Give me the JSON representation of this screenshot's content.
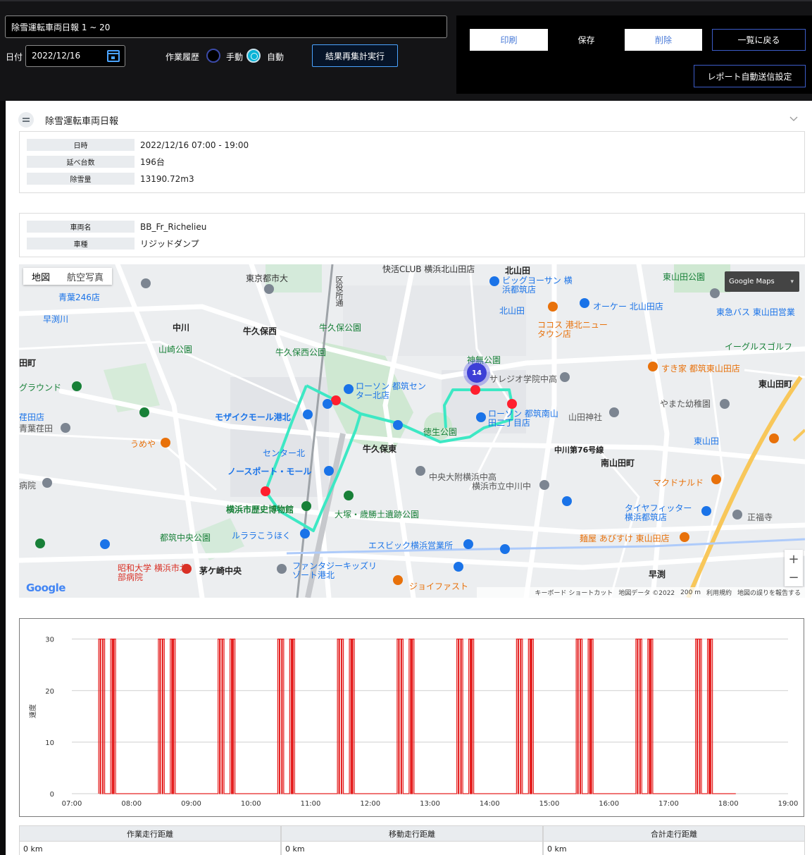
{
  "header": {
    "title_value": "除雪運転車両日報 1 ~ 20",
    "date_label": "日付",
    "date_value": "2022/12/16",
    "history_label": "作業履歴",
    "radio_manual": "手動",
    "radio_auto": "自動",
    "selected_mode": "自動",
    "recalc_button": "結果再集計実行"
  },
  "actions": {
    "print": "印刷",
    "save": "保存",
    "delete": "削除",
    "back": "一覧に戻る",
    "report": "レポート自動送信設定"
  },
  "section": {
    "title": "除雪運転車両日報"
  },
  "summary": [
    {
      "key": "日時",
      "value": "2022/12/16 07:00 - 19:00"
    },
    {
      "key": "延べ台数",
      "value": "196台"
    },
    {
      "key": "除雪量",
      "value": "13190.72m3"
    }
  ],
  "vehicle": [
    {
      "key": "車両名",
      "value": "BB_Fr_Richelieu"
    },
    {
      "key": "車種",
      "value": "リジッドダンプ"
    }
  ],
  "map": {
    "type_map": "地図",
    "type_satellite": "航空写真",
    "badge": "Google Maps",
    "cluster_count": "14",
    "google": "Google",
    "footer": [
      "キーボード ショートカット",
      "地図データ ©2022",
      "200 m",
      "利用規約",
      "地図の誤りを報告する"
    ],
    "labels": [
      {
        "text": "東京都市大",
        "color": "#333"
      },
      {
        "text": "快活CLUB 横浜北山田店",
        "color": "#333"
      },
      {
        "text": "北山田",
        "color": "#222"
      },
      {
        "text": "ビッグヨーサン 横浜都筑店",
        "color": "#1a73e8"
      },
      {
        "text": "オーケー 北山田店",
        "color": "#1a73e8"
      },
      {
        "text": "東山田公園",
        "color": "#188038"
      },
      {
        "text": "東急バス 東山田営業",
        "color": "#1a73e8"
      },
      {
        "text": "中川",
        "color": "#222"
      },
      {
        "text": "牛久保西",
        "color": "#222"
      },
      {
        "text": "牛久保公園",
        "color": "#188038"
      },
      {
        "text": "ココス 港北ニュータウン店",
        "color": "#e8710a"
      },
      {
        "text": "イーグルスゴルフ",
        "color": "#188038"
      },
      {
        "text": "山崎公園",
        "color": "#188038"
      },
      {
        "text": "牛久保西公園",
        "color": "#188038"
      },
      {
        "text": "神無公園",
        "color": "#188038"
      },
      {
        "text": "サレジオ学院中高",
        "color": "#555"
      },
      {
        "text": "すき家 都筑東山田店",
        "color": "#e8710a"
      },
      {
        "text": "東山田町",
        "color": "#222"
      },
      {
        "text": "ローソン 都筑センター北店",
        "color": "#1a73e8"
      },
      {
        "text": "やまた幼稚園",
        "color": "#555"
      },
      {
        "text": "ローソン 都筑南山田二丁目店",
        "color": "#1a73e8"
      },
      {
        "text": "山田神社",
        "color": "#555"
      },
      {
        "text": "モザイクモール港北",
        "color": "#1a73e8"
      },
      {
        "text": "徳生公園",
        "color": "#188038"
      },
      {
        "text": "うめや",
        "color": "#e8710a"
      },
      {
        "text": "牛久保東",
        "color": "#222"
      },
      {
        "text": "中川第76号線",
        "color": "#222"
      },
      {
        "text": "南山田町",
        "color": "#222"
      },
      {
        "text": "センター北",
        "color": "#1a73e8"
      },
      {
        "text": "ノースポート・モール",
        "color": "#1a73e8"
      },
      {
        "text": "中央大附横浜中高",
        "color": "#555"
      },
      {
        "text": "横浜市立中川中",
        "color": "#555"
      },
      {
        "text": "マクドナルド",
        "color": "#e8710a"
      },
      {
        "text": "横浜市歴史博物館",
        "color": "#188038"
      },
      {
        "text": "大塚・歳勝土遺跡公園",
        "color": "#188038"
      },
      {
        "text": "タイヤフィッター 横浜都筑店",
        "color": "#1a73e8"
      },
      {
        "text": "正福寺",
        "color": "#555"
      },
      {
        "text": "都筑中央公園",
        "color": "#188038"
      },
      {
        "text": "ルララこうほく",
        "color": "#1a73e8"
      },
      {
        "text": "エスビック横浜営業所",
        "color": "#1a73e8"
      },
      {
        "text": "麺屋 あびすけ 東山田店",
        "color": "#e8710a"
      },
      {
        "text": "昭和大学 横浜市北部病院",
        "color": "#d93025"
      },
      {
        "text": "茅ケ崎中央",
        "color": "#222"
      },
      {
        "text": "ファンタジーキッズリゾート港北",
        "color": "#1a73e8"
      },
      {
        "text": "ジョイファスト",
        "color": "#e8710a"
      },
      {
        "text": "早渕",
        "color": "#222"
      },
      {
        "text": "早渕川",
        "color": "#1a73e8"
      },
      {
        "text": "青葉246店",
        "color": "#1a73e8"
      },
      {
        "text": "区役所通",
        "color": "#333"
      },
      {
        "text": "田町",
        "color": "#222"
      },
      {
        "text": "グラウンド",
        "color": "#188038"
      },
      {
        "text": "荏田店",
        "color": "#1a73e8"
      },
      {
        "text": "青葉荏田",
        "color": "#555"
      },
      {
        "text": "病院",
        "color": "#555"
      },
      {
        "text": "北山田",
        "color": "#1a73e8"
      },
      {
        "text": "東山田",
        "color": "#1a73e8"
      }
    ],
    "route_color": "#3de8c4",
    "marker_color": "#ff1f2e"
  },
  "chart_data": {
    "type": "line",
    "xlabel": "",
    "ylabel": "速度",
    "x_ticks": [
      "07:00",
      "08:00",
      "09:00",
      "10:00",
      "11:00",
      "12:00",
      "13:00",
      "14:00",
      "15:00",
      "16:00",
      "17:00",
      "18:00",
      "19:00"
    ],
    "y_ticks": [
      0,
      10,
      20,
      30
    ],
    "ylim": [
      0,
      32
    ],
    "xlim": [
      "07:00",
      "19:00"
    ],
    "grid": true,
    "line_color": "#e52020",
    "series": [
      {
        "pulses": [
          [
            "07:27",
            "07:33"
          ],
          [
            "07:39",
            "07:44"
          ],
          [
            "08:27",
            "08:33"
          ],
          [
            "08:39",
            "08:44"
          ],
          [
            "09:27",
            "09:33"
          ],
          [
            "09:39",
            "09:44"
          ],
          [
            "10:27",
            "10:33"
          ],
          [
            "10:39",
            "10:44"
          ],
          [
            "11:27",
            "11:33"
          ],
          [
            "11:39",
            "11:44"
          ],
          [
            "12:27",
            "12:33"
          ],
          [
            "12:39",
            "12:44"
          ],
          [
            "13:27",
            "13:33"
          ],
          [
            "13:39",
            "13:44"
          ],
          [
            "14:27",
            "14:33"
          ],
          [
            "14:39",
            "14:44"
          ],
          [
            "15:27",
            "15:33"
          ],
          [
            "15:39",
            "15:44"
          ],
          [
            "16:27",
            "16:33"
          ],
          [
            "16:39",
            "16:44"
          ],
          [
            "17:27",
            "17:33"
          ],
          [
            "17:39",
            "17:44"
          ]
        ],
        "pulse_value": 30,
        "baseline_value": 0,
        "start": "07:27",
        "end": "17:25"
      }
    ]
  },
  "distance": {
    "headers": [
      "作業走行距離",
      "移動走行距離",
      "合計走行距離"
    ],
    "values": [
      "0 km",
      "0 km",
      "0 km"
    ]
  }
}
